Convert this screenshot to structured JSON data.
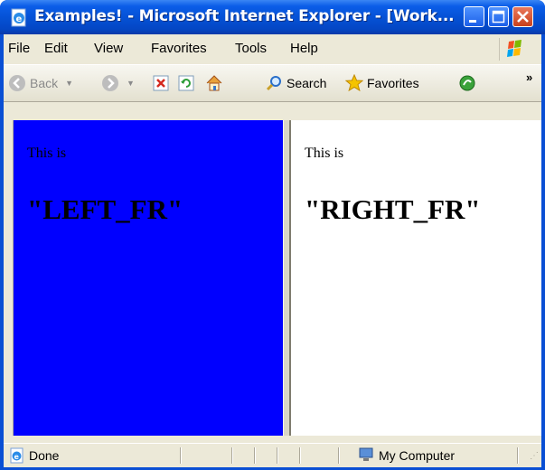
{
  "window": {
    "title": "Examples! - Microsoft Internet Explorer - [Work...",
    "controls": [
      "minimize",
      "maximize",
      "close"
    ]
  },
  "menu": {
    "items": [
      "File",
      "Edit",
      "View",
      "Favorites",
      "Tools",
      "Help"
    ]
  },
  "toolbar": {
    "back_label": "Back",
    "search_label": "Search",
    "favorites_label": "Favorites",
    "more_label": "»"
  },
  "frames": {
    "left": {
      "line1": "This is",
      "line2": "\"LEFT_FR\"",
      "background": "#0000ff"
    },
    "right": {
      "line1": "This is",
      "line2": "\"RIGHT_FR\"",
      "background": "#ffffff"
    }
  },
  "status": {
    "text": "Done",
    "zone": "My Computer"
  },
  "icons": [
    "ie-page-icon",
    "windows-logo-icon",
    "back-icon",
    "forward-icon",
    "stop-icon",
    "refresh-icon",
    "home-icon",
    "search-icon",
    "favorites-star-icon",
    "media-icon",
    "my-computer-icon"
  ],
  "colors": {
    "titlebar": "#0552d6",
    "chrome": "#ece9d8"
  }
}
